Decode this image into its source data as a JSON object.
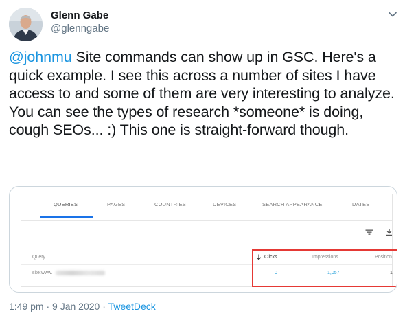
{
  "author": {
    "name": "Glenn Gabe",
    "handle": "@glenngabe"
  },
  "tweet": {
    "mention": "@johnmu",
    "text": " Site commands can show up in GSC. Here's a quick example. I see this across a number of sites I have access to and some of them are very interesting to analyze. You can see the types of research *someone* is doing, cough SEOs... :) This one is straight-forward though."
  },
  "screenshot": {
    "tabs": [
      "QUERIES",
      "PAGES",
      "COUNTRIES",
      "DEVICES",
      "SEARCH APPEARANCE",
      "DATES"
    ],
    "active_tab": "QUERIES",
    "table": {
      "headers": {
        "query": "Query",
        "clicks": "Clicks",
        "impressions": "Impressions",
        "position": "Position"
      },
      "row": {
        "query": "site:www.",
        "clicks": "0",
        "impressions": "1,057",
        "position": "1"
      }
    },
    "icons": [
      "filter-icon",
      "download-icon",
      "sort-down-arrow-icon"
    ],
    "accent_color": "#1a73e8",
    "highlight_color": "#e53935"
  },
  "meta": {
    "time": "1:49 pm",
    "date": "9 Jan 2020",
    "separator": "·",
    "source": "TweetDeck"
  },
  "colors": {
    "link": "#1b95e0",
    "secondary": "#657786"
  }
}
